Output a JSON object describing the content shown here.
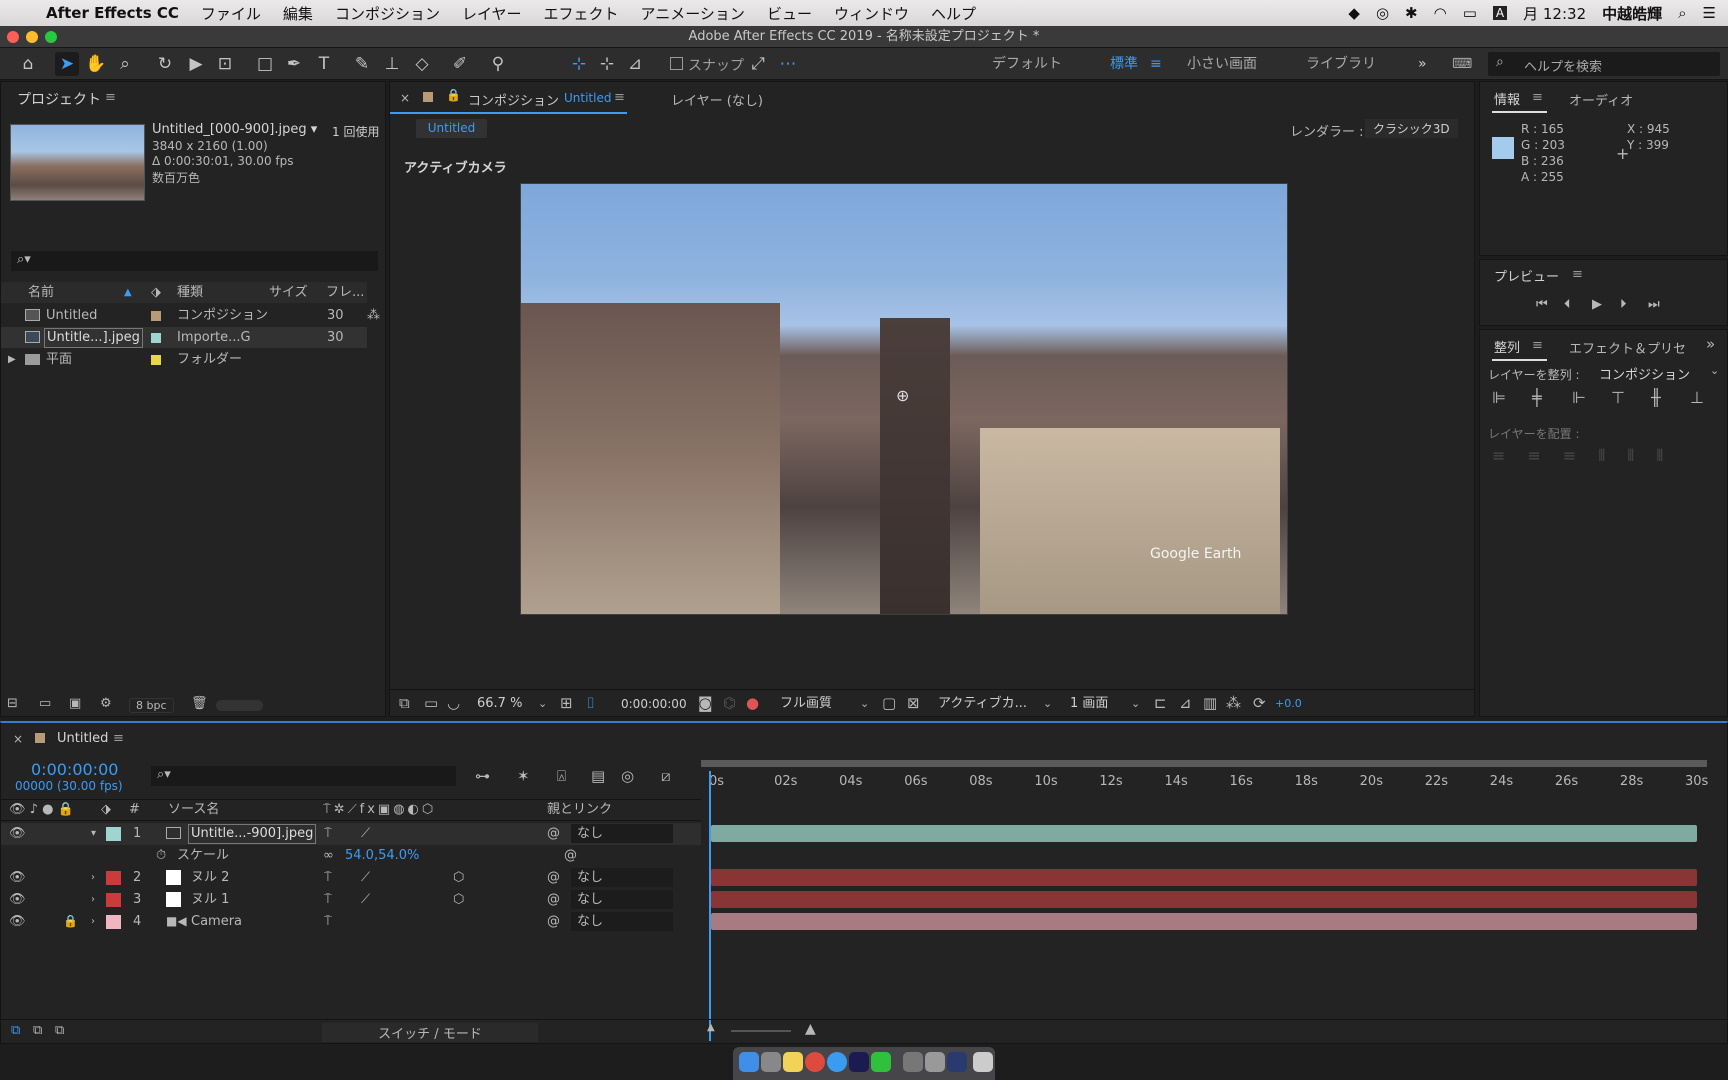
{
  "menubar": {
    "app": "After Effects CC",
    "items": [
      "ファイル",
      "編集",
      "コンポジション",
      "レイヤー",
      "エフェクト",
      "アニメーション",
      "ビュー",
      "ウィンドウ",
      "ヘルプ"
    ],
    "clock": "月 12:32",
    "user": "中越皓輝",
    "input_mode": "A"
  },
  "window_title": "Adobe After Effects CC 2019 - 名称未設定プロジェクト *",
  "toolbar": {
    "snap_label": "スナップ",
    "workspaces": [
      "デフォルト",
      "標準",
      "小さい画面",
      "ライブラリ"
    ],
    "active_workspace": "標準",
    "help_placeholder": "ヘルプを検索"
  },
  "project": {
    "title": "プロジェクト",
    "thumb_name": "Untitled_[000-900].jpeg ▾",
    "usage": "1 回使用",
    "dims": "3840 x 2160 (1.00)",
    "duration": "Δ 0:00:30:01, 30.00 fps",
    "colors": "数百万色",
    "columns": [
      "名前",
      "種類",
      "サイズ",
      "フレ..."
    ],
    "items": [
      {
        "name": "Untitled",
        "type": "コンポジション",
        "size": "30",
        "color": "#b89a78"
      },
      {
        "name": "Untitle...].jpeg",
        "type": "Importe...G",
        "size": "30",
        "color": "#9fd4d0"
      },
      {
        "name": "平面",
        "type": "フォルダー",
        "size": "",
        "color": "#e8d64a"
      }
    ],
    "bpc": "8 bpc"
  },
  "comp": {
    "tab_prefix": "コンポジション",
    "tab_name": "Untitled",
    "layer_tab": "レイヤー (なし)",
    "flow_chip": "Untitled",
    "renderer_label": "レンダラー :",
    "renderer": "クラシック3D",
    "camera_label": "アクティブカメラ",
    "watermark": "Google Earth",
    "controls": {
      "zoom": "66.7 %",
      "timecode": "0:00:00:00",
      "quality": "フル画質",
      "camera": "アクティブカ...",
      "views": "1 画面",
      "exposure": "+0.0"
    }
  },
  "info": {
    "tab": "情報",
    "tab2": "オーディオ",
    "r": "R :  165",
    "g": "G :  203",
    "b": "B :  236",
    "a": "A :  255",
    "x": "X :  945",
    "y": "Y :  399",
    "swatch": "#a5cbec"
  },
  "preview": {
    "title": "プレビュー"
  },
  "align": {
    "tab": "整列",
    "tab2": "エフェクト＆プリセ",
    "align_to_label": "レイヤーを整列 :",
    "align_to": "コンポジション",
    "distribute_label": "レイヤーを配置 :"
  },
  "timeline": {
    "tab": "Untitled",
    "timecode": "0:00:00:00",
    "frames": "00000 (30.00 fps)",
    "col_source": "ソース名",
    "col_parent": "親とリンク",
    "switch_mode": "スイッチ / モード",
    "ruler": [
      "0s",
      "02s",
      "04s",
      "06s",
      "08s",
      "10s",
      "12s",
      "14s",
      "16s",
      "18s",
      "20s",
      "22s",
      "24s",
      "26s",
      "28s",
      "30s"
    ],
    "layers": [
      {
        "num": "1",
        "name": "Untitle...-900].jpeg",
        "label": "#9fd4d0",
        "parent": "なし",
        "bar": "#7faa9f"
      },
      {
        "num": "2",
        "name": "ヌル 2",
        "label": "#cc3b3b",
        "parent": "なし",
        "bar": "#8a3535"
      },
      {
        "num": "3",
        "name": "ヌル 1",
        "label": "#cc3b3b",
        "parent": "なし",
        "bar": "#8a3535"
      },
      {
        "num": "4",
        "name": "Camera",
        "label": "#f0b5bf",
        "parent": "なし",
        "bar": "#a87a82"
      }
    ],
    "scale_label": "スケール",
    "scale_value": "54.0,54.0%"
  }
}
